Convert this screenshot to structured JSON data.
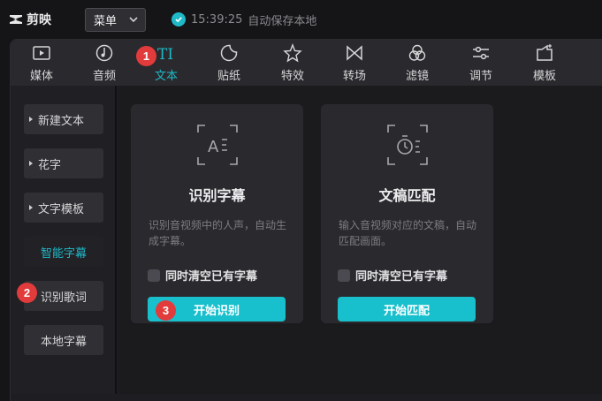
{
  "app": {
    "name": "剪映"
  },
  "menu": {
    "label": "菜单"
  },
  "status": {
    "time": "15:39:25",
    "text": "自动保存本地"
  },
  "toolbar": {
    "items": [
      {
        "label": "媒体",
        "icon": "media-icon"
      },
      {
        "label": "音频",
        "icon": "audio-icon"
      },
      {
        "label": "文本",
        "icon": "text-icon",
        "active": true
      },
      {
        "label": "贴纸",
        "icon": "sticker-icon"
      },
      {
        "label": "特效",
        "icon": "effects-icon"
      },
      {
        "label": "转场",
        "icon": "transition-icon"
      },
      {
        "label": "滤镜",
        "icon": "filter-icon"
      },
      {
        "label": "调节",
        "icon": "adjust-icon"
      },
      {
        "label": "模板",
        "icon": "template-icon"
      }
    ]
  },
  "sidebar": {
    "items": [
      {
        "label": "新建文本",
        "expandable": true
      },
      {
        "label": "花字",
        "expandable": true
      },
      {
        "label": "文字模板",
        "expandable": true
      },
      {
        "label": "智能字幕",
        "active": true
      },
      {
        "label": "识别歌词"
      },
      {
        "label": "本地字幕"
      }
    ]
  },
  "cards": [
    {
      "title": "识别字幕",
      "desc": "识别音视频中的人声，自动生成字幕。",
      "checkbox": "同时清空已有字幕",
      "button": "开始识别"
    },
    {
      "title": "文稿匹配",
      "desc": "输入音视频对应的文稿，自动匹配画面。",
      "checkbox": "同时清空已有字幕",
      "button": "开始匹配"
    }
  ],
  "badges": {
    "one": "1",
    "two": "2",
    "three": "3"
  },
  "colors": {
    "accent": "#1fb9c8",
    "badge": "#e23b3b",
    "background": "#1b1b1e"
  }
}
